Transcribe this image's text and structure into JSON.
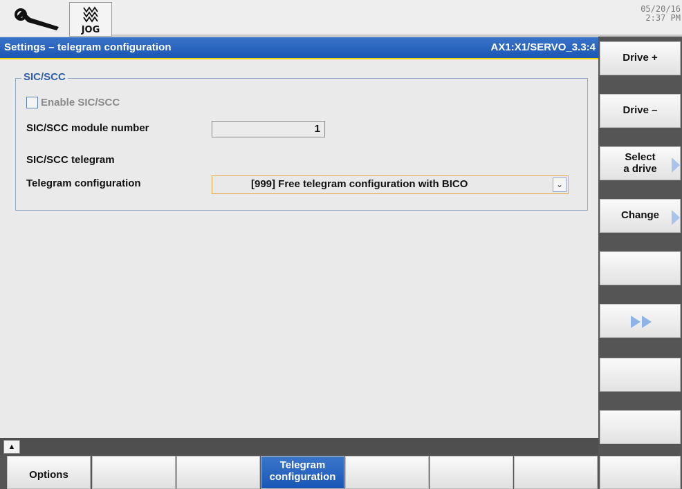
{
  "header": {
    "mode_label": "JOG",
    "date": "05/20/16",
    "time": "2:37 PM"
  },
  "titlebar": {
    "title": "Settings – telegram configuration",
    "axis_path": "AX1:X1/SERVO_3.3:4"
  },
  "group": {
    "title": "SIC/SCC",
    "enable_label": "Enable SIC/SCC",
    "module_label": "SIC/SCC module number",
    "module_value": "1",
    "telegram_label": "SIC/SCC telegram",
    "config_label": "Telegram configuration",
    "config_value": "[999] Free telegram configuration with BICO"
  },
  "softkeys_right": {
    "drive_plus": "Drive +",
    "drive_minus": "Drive –",
    "select_line1": "Select",
    "select_line2": "a drive",
    "change": "Change"
  },
  "softkeys_bottom": {
    "options": "Options",
    "telegram_line1": "Telegram",
    "telegram_line2": "configuration"
  },
  "icons": {
    "wrench": "wrench-icon",
    "jog": "jog-icon",
    "forward": "double-forward-icon",
    "scroll_up": "scroll-up-icon"
  },
  "colors": {
    "title_bar": "#1a56b4",
    "accent_underline": "#f2d400",
    "group_title": "#2d5ea8",
    "dropdown_border": "#e8a84c"
  }
}
